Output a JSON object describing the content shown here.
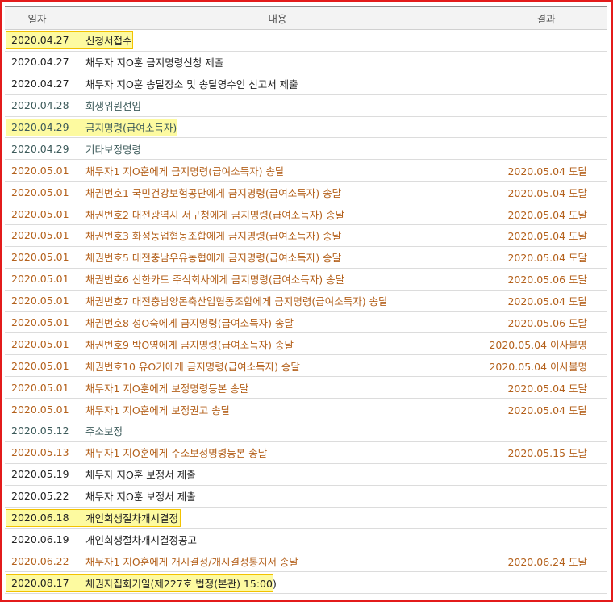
{
  "columns": {
    "date": "일자",
    "content": "내용",
    "result": "결과"
  },
  "rows": [
    {
      "date": "2020.04.27",
      "content": "신청서접수",
      "result": "",
      "color": "black",
      "highlight": true
    },
    {
      "date": "2020.04.27",
      "content": "채무자 지O훈 금지명령신청 제출",
      "result": "",
      "color": "black",
      "highlight": false
    },
    {
      "date": "2020.04.27",
      "content": "채무자 지O훈 송달장소 및 송달영수인 신고서 제출",
      "result": "",
      "color": "black",
      "highlight": false
    },
    {
      "date": "2020.04.28",
      "content": "회생위원선임",
      "result": "",
      "color": "teal",
      "highlight": false
    },
    {
      "date": "2020.04.29",
      "content": "금지명령(급여소득자)",
      "result": "",
      "color": "teal",
      "highlight": true
    },
    {
      "date": "2020.04.29",
      "content": "기타보정명령",
      "result": "",
      "color": "teal",
      "highlight": false
    },
    {
      "date": "2020.05.01",
      "content": "채무자1 지O훈에게 금지명령(급여소득자) 송달",
      "result": "2020.05.04 도달",
      "color": "orange",
      "highlight": false
    },
    {
      "date": "2020.05.01",
      "content": "채권번호1 국민건강보험공단에게 금지명령(급여소득자) 송달",
      "result": "2020.05.04 도달",
      "color": "orange",
      "highlight": false
    },
    {
      "date": "2020.05.01",
      "content": "채권번호2 대전광역시 서구청에게 금지명령(급여소득자) 송달",
      "result": "2020.05.04 도달",
      "color": "orange",
      "highlight": false
    },
    {
      "date": "2020.05.01",
      "content": "채권번호3 화성농업협동조합에게 금지명령(급여소득자) 송달",
      "result": "2020.05.04 도달",
      "color": "orange",
      "highlight": false
    },
    {
      "date": "2020.05.01",
      "content": "채권번호5 대전충남우유농협에게 금지명령(급여소득자) 송달",
      "result": "2020.05.04 도달",
      "color": "orange",
      "highlight": false
    },
    {
      "date": "2020.05.01",
      "content": "채권번호6 신한카드 주식회사에게 금지명령(급여소득자) 송달",
      "result": "2020.05.06 도달",
      "color": "orange",
      "highlight": false
    },
    {
      "date": "2020.05.01",
      "content": "채권번호7 대전충남양돈축산업협동조합에게 금지명령(급여소득자) 송달",
      "result": "2020.05.04 도달",
      "color": "orange",
      "highlight": false
    },
    {
      "date": "2020.05.01",
      "content": "채권번호8 성O숙에게 금지명령(급여소득자) 송달",
      "result": "2020.05.06 도달",
      "color": "orange",
      "highlight": false
    },
    {
      "date": "2020.05.01",
      "content": "채권번호9 박O영에게 금지명령(급여소득자) 송달",
      "result": "2020.05.04 이사불명",
      "color": "orange",
      "highlight": false
    },
    {
      "date": "2020.05.01",
      "content": "채권번호10 유O기에게 금지명령(급여소득자) 송달",
      "result": "2020.05.04 이사불명",
      "color": "orange",
      "highlight": false
    },
    {
      "date": "2020.05.01",
      "content": "채무자1 지O훈에게 보정명령등본 송달",
      "result": "2020.05.04 도달",
      "color": "orange",
      "highlight": false
    },
    {
      "date": "2020.05.01",
      "content": "채무자1 지O훈에게 보정권고 송달",
      "result": "2020.05.04 도달",
      "color": "orange",
      "highlight": false
    },
    {
      "date": "2020.05.12",
      "content": "주소보정",
      "result": "",
      "color": "teal",
      "highlight": false
    },
    {
      "date": "2020.05.13",
      "content": "채무자1 지O훈에게 주소보정명령등본 송달",
      "result": "2020.05.15 도달",
      "color": "orange",
      "highlight": false
    },
    {
      "date": "2020.05.19",
      "content": "채무자 지O훈 보정서 제출",
      "result": "",
      "color": "black",
      "highlight": false
    },
    {
      "date": "2020.05.22",
      "content": "채무자 지O훈 보정서 제출",
      "result": "",
      "color": "black",
      "highlight": false
    },
    {
      "date": "2020.06.18",
      "content": "개인회생절차개시결정",
      "result": "",
      "color": "black",
      "highlight": true
    },
    {
      "date": "2020.06.19",
      "content": "개인회생절차개시결정공고",
      "result": "",
      "color": "black",
      "highlight": false
    },
    {
      "date": "2020.06.22",
      "content": "채무자1 지O훈에게 개시결정/개시결정통지서 송달",
      "result": "2020.06.24 도달",
      "color": "orange",
      "highlight": false
    },
    {
      "date": "2020.08.17",
      "content": "채권자집회기일(제227호 법정(본관) 15:00)",
      "result": "",
      "color": "black",
      "highlight": true
    }
  ]
}
